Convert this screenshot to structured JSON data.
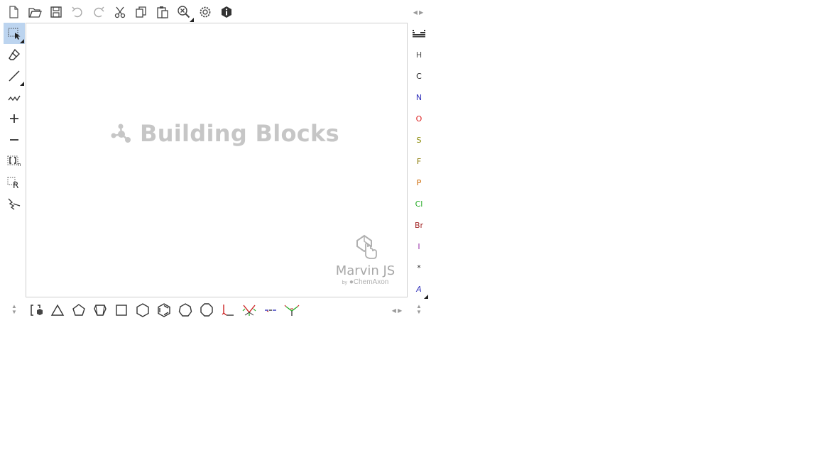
{
  "top_toolbar": {
    "tools": [
      {
        "name": "new-document-icon"
      },
      {
        "name": "open-folder-icon"
      },
      {
        "name": "save-icon"
      },
      {
        "name": "undo-icon"
      },
      {
        "name": "redo-icon"
      },
      {
        "name": "cut-icon"
      },
      {
        "name": "copy-icon"
      },
      {
        "name": "paste-icon"
      },
      {
        "name": "zoom-icon"
      },
      {
        "name": "settings-gear-icon"
      },
      {
        "name": "info-icon"
      }
    ]
  },
  "left_toolbar": {
    "tools": [
      {
        "name": "rectangle-select-icon",
        "active": true
      },
      {
        "name": "eraser-icon"
      },
      {
        "name": "single-bond-icon"
      },
      {
        "name": "chain-icon"
      },
      {
        "name": "increase-charge-icon",
        "label": "+"
      },
      {
        "name": "decrease-charge-icon",
        "label": "−"
      },
      {
        "name": "bracket-sgroup-icon",
        "label": "[ ]n"
      },
      {
        "name": "rgroup-icon",
        "label": "R"
      },
      {
        "name": "reaction-arrow-icon"
      }
    ]
  },
  "canvas": {
    "watermark": "Building Blocks",
    "brand_title": "Marvin JS",
    "brand_by": "by",
    "brand_company": "ChemAxon"
  },
  "periodic": {
    "elements": [
      {
        "symbol": "H",
        "color": "#555555"
      },
      {
        "symbol": "C",
        "color": "#222222"
      },
      {
        "symbol": "N",
        "color": "#3333bb"
      },
      {
        "symbol": "O",
        "color": "#dd2222"
      },
      {
        "symbol": "S",
        "color": "#888800"
      },
      {
        "symbol": "F",
        "color": "#887700"
      },
      {
        "symbol": "P",
        "color": "#cc6600"
      },
      {
        "symbol": "Cl",
        "color": "#22aa22"
      },
      {
        "symbol": "Br",
        "color": "#a52a2a"
      },
      {
        "symbol": "I",
        "color": "#9933aa"
      },
      {
        "symbol": "*",
        "color": "#333333"
      },
      {
        "symbol": "A",
        "color": "#3333bb"
      }
    ]
  },
  "bottom_toolbar": {
    "templates": [
      "template-library-icon",
      "cyclopropane-icon",
      "cyclopentane-icon",
      "cyclopentane-house-icon",
      "cyclobutane-icon",
      "cyclohexane-icon",
      "benzene-icon",
      "cycloheptane-icon",
      "cyclooctane-icon",
      "chair-conformation-icon",
      "bicyclic-template-icon",
      "naphthalene-template-icon",
      "cyclopropyl-template-icon"
    ]
  }
}
